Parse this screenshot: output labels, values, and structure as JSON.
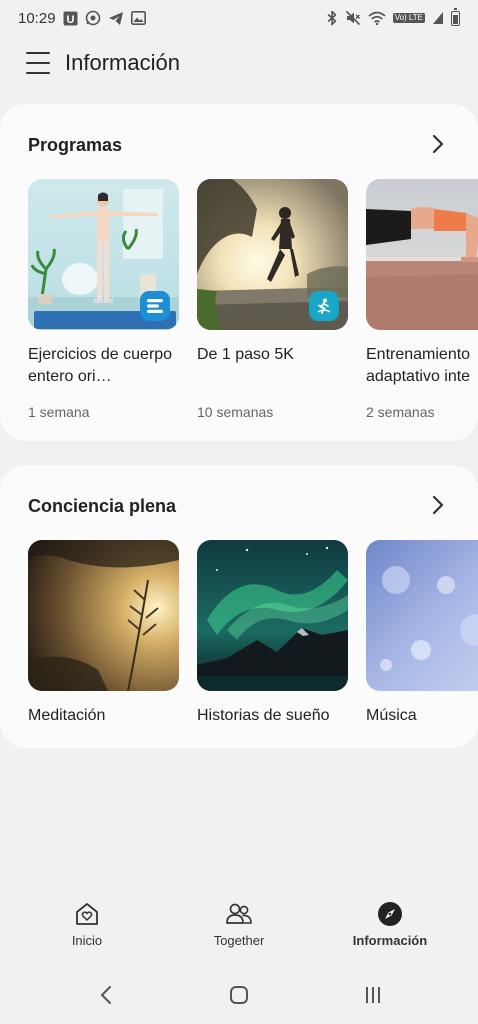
{
  "status_bar": {
    "time": "10:29",
    "left_icons": [
      "u-app-icon",
      "whatsapp-icon",
      "telegram-icon",
      "gallery-icon"
    ],
    "right_icons": [
      "bluetooth-icon",
      "mute-icon",
      "wifi-icon",
      "volte-icon",
      "signal-icon",
      "battery-icon"
    ],
    "volte_text": "Vo) LTE"
  },
  "app_bar": {
    "title": "Información",
    "menu_icon": "hamburger-menu-icon"
  },
  "sections": [
    {
      "title": "Programas",
      "items": [
        {
          "title": "Ejercicios de cuerpo entero ori…",
          "meta": "1 semana",
          "badge": "list-badge-icon",
          "badge_color": "#1b8ed6"
        },
        {
          "title": "De 1 paso 5K",
          "meta": "10 semanas",
          "badge": "runner-badge-icon",
          "badge_color": "#18a7c9"
        },
        {
          "title": "Entrenamiento adaptativo inte",
          "meta": "2 semanas"
        }
      ]
    },
    {
      "title": "Conciencia plena",
      "items": [
        {
          "title": "Meditación"
        },
        {
          "title": "Historias de sueño"
        },
        {
          "title": "Música"
        }
      ]
    }
  ],
  "bottom_nav": {
    "items": [
      {
        "label": "Inicio",
        "icon": "home-heart-icon"
      },
      {
        "label": "Together",
        "icon": "people-icon"
      },
      {
        "label": "Información",
        "icon": "compass-icon",
        "active": true
      }
    ]
  },
  "system_nav": [
    "back-icon",
    "home-icon",
    "recents-icon"
  ],
  "colors": {
    "background": "#f1f1f1",
    "card": "#fbfbfb",
    "text": "#222222",
    "meta_text": "#666666"
  }
}
